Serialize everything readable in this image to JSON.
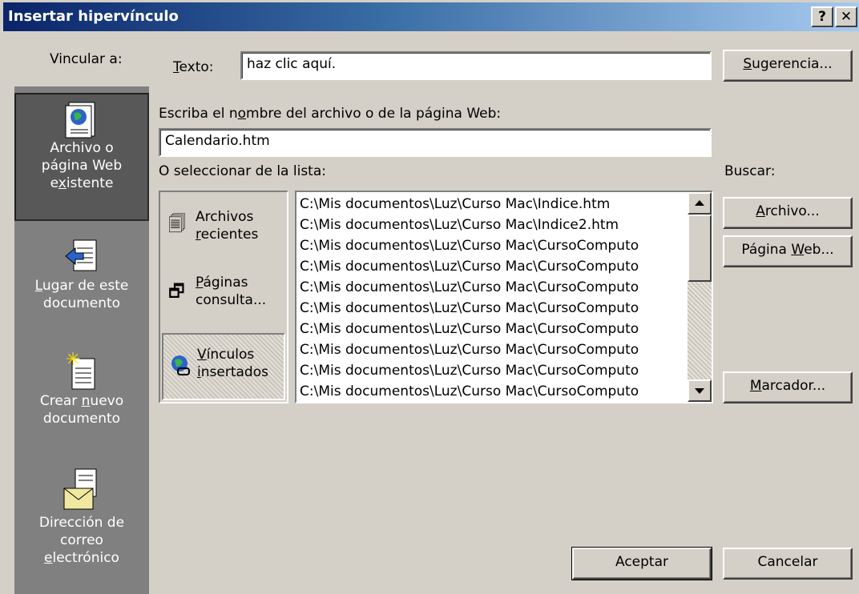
{
  "window": {
    "title": "Insertar hipervínculo",
    "help_btn": "?",
    "close_btn": "✕"
  },
  "sidebar": {
    "label": "Vincular a:",
    "items": [
      {
        "line1": "Archivo o",
        "line2": "página Web",
        "line3_pre": "e",
        "line3_u": "x",
        "line3_post": "istente"
      },
      {
        "line1_u": "L",
        "line1_post": "ugar de este",
        "line2": "documento"
      },
      {
        "line1_pre": "Crear ",
        "line1_u": "n",
        "line1_post": "uevo",
        "line2": "documento"
      },
      {
        "line1": "Dirección de",
        "line2": "correo",
        "line3_u": "e",
        "line3_post": "lectrónico"
      }
    ]
  },
  "text_field": {
    "label_u": "T",
    "label_post": "exto:",
    "value": "haz clic aquí."
  },
  "suggest_btn": {
    "u": "S",
    "post": "ugerencia..."
  },
  "address": {
    "label_pre": "Escriba el n",
    "label_u": "o",
    "label_post": "mbre del archivo o de la página Web:",
    "value": "Calendario.htm"
  },
  "list_label": "O seleccionar de la lista:",
  "search_label": "Buscar:",
  "bar": [
    {
      "line1": "Archivos",
      "line2_u": "r",
      "line2_post": "ecientes"
    },
    {
      "line1_u": "P",
      "line1_post": "áginas",
      "line2": "consulta..."
    },
    {
      "line1_u": "V",
      "line1_post": "ínculos",
      "line2_u": "i",
      "line2_post": "nsertados"
    }
  ],
  "files": [
    "C:\\Mis documentos\\Luz\\Curso Mac\\Indice.htm",
    "C:\\Mis documentos\\Luz\\Curso Mac\\Indice2.htm",
    "C:\\Mis documentos\\Luz\\Curso Mac\\CursoComputo",
    "C:\\Mis documentos\\Luz\\Curso Mac\\CursoComputo",
    "C:\\Mis documentos\\Luz\\Curso Mac\\CursoComputo",
    "C:\\Mis documentos\\Luz\\Curso Mac\\CursoComputo",
    "C:\\Mis documentos\\Luz\\Curso Mac\\CursoComputo",
    "C:\\Mis documentos\\Luz\\Curso Mac\\CursoComputo",
    "C:\\Mis documentos\\Luz\\Curso Mac\\CursoComputo",
    "C:\\Mis documentos\\Luz\\Curso Mac\\CursoComputo"
  ],
  "buttons": {
    "file": {
      "u": "A",
      "post": "rchivo..."
    },
    "web": {
      "pre": "Página ",
      "u": "W",
      "post": "eb..."
    },
    "bookmark": {
      "u": "M",
      "post": "arcador..."
    },
    "ok": "Aceptar",
    "cancel": "Cancelar"
  }
}
